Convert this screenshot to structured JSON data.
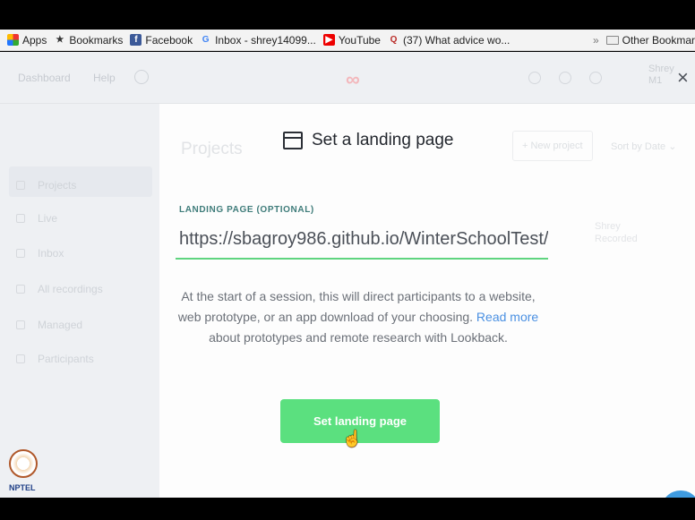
{
  "bookmarks_bar": {
    "items": [
      {
        "label": "Apps",
        "icon": "apps-grid-icon"
      },
      {
        "label": "Bookmarks",
        "icon": "star-icon"
      },
      {
        "label": "Facebook",
        "icon": "facebook-icon"
      },
      {
        "label": "Inbox - shrey14099...",
        "icon": "google-icon"
      },
      {
        "label": "YouTube",
        "icon": "youtube-icon"
      },
      {
        "label": "(37) What advice wo...",
        "icon": "quora-icon"
      }
    ],
    "overflow": "»",
    "other_bookmarks": "Other Bookmar"
  },
  "app_nav": {
    "dashboard": "Dashboard",
    "help": "Help",
    "user_name": "Shrey",
    "user_sub": "M1"
  },
  "sidebar": {
    "items": [
      "Projects",
      "Live",
      "Inbox",
      "All recordings",
      "Managed",
      "Participants"
    ]
  },
  "background": {
    "page_title": "Projects",
    "new_project": "+ New project",
    "sort_by": "Sort by Date ⌄",
    "user_card_name": "Shrey",
    "user_card_role": "Recorded"
  },
  "modal": {
    "title": "Set a landing page",
    "field_label": "LANDING PAGE (OPTIONAL)",
    "field_value": "https://sbagroy986.github.io/WinterSchoolTest/",
    "desc_before": "At the start of a session, this will direct participants to a website, web prototype, or an app download of your choosing.",
    "desc_link": "Read more",
    "desc_after": "about prototypes and remote research with Lookback.",
    "button": "Set landing page",
    "close": "×"
  },
  "watermark": {
    "label": "NPTEL"
  },
  "colors": {
    "accent_green": "#5be07f",
    "underline_green": "#5fd47f",
    "link_blue": "#4a90e2",
    "label_teal": "#3f7c7a"
  }
}
